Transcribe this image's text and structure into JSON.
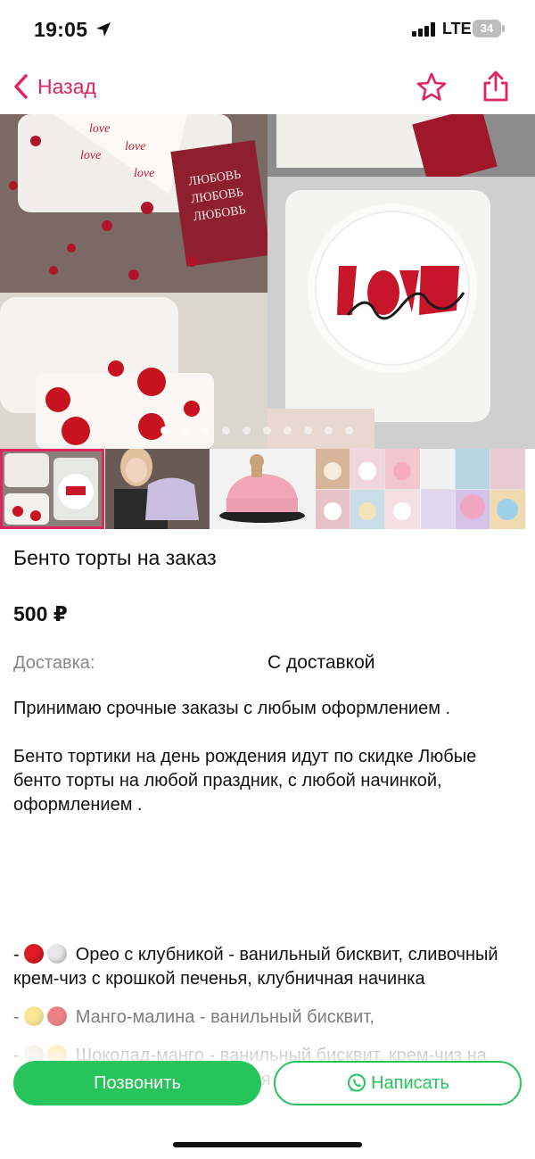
{
  "status_bar": {
    "time": "19:05",
    "network": "LTE",
    "battery": "34"
  },
  "nav": {
    "back_label": "Назад"
  },
  "gallery": {
    "total_dots": 10,
    "active_dot": 0,
    "hero_texts": [
      "ЛЮБОВЬ",
      "ЛЮБОВЬ",
      "ЛЮБОВЬ"
    ]
  },
  "listing": {
    "title": "Бенто торты на заказ",
    "price": "500 ₽",
    "delivery_label": "Доставка:",
    "delivery_value": "С доставкой",
    "description": "Принимаю срочные заказы  с любым оформлением  .\n\nБенто тортики на день рождения идут по скидке Любые бенто торты на любой праздник, с любой начинкой, оформлением ."
  },
  "flavors": [
    {
      "prefix": "- ",
      "text": "Орео с клубникой - ванильный бисквит, сливочный крем-чиз с крошкой печенья, клубничная начинка",
      "dots": [
        "red",
        "white"
      ]
    },
    {
      "prefix": "- ",
      "text": "Манго-малина - ванильный бисквит, ",
      "dots": [
        "yellow",
        "red"
      ]
    },
    {
      "prefix": "- ",
      "text": "Шоколад-манго - ванильный бисквит, крем-чиз на молочном шоколаде, манговая",
      "dots": [
        "beige",
        "yellow"
      ]
    }
  ],
  "actions": {
    "call_label": "Позвонить",
    "write_label": "Написать"
  },
  "colors": {
    "accent": "#e0245e",
    "green": "#27c45c"
  }
}
